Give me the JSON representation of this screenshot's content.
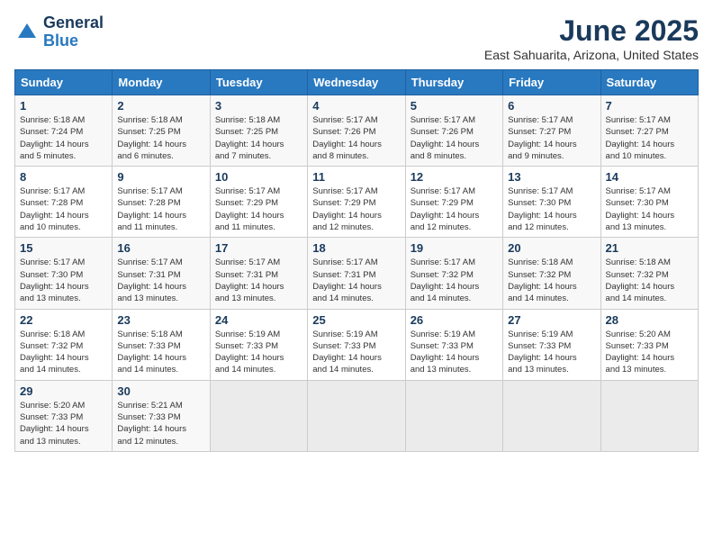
{
  "header": {
    "logo_line1": "General",
    "logo_line2": "Blue",
    "title": "June 2025",
    "subtitle": "East Sahuarita, Arizona, United States"
  },
  "weekdays": [
    "Sunday",
    "Monday",
    "Tuesday",
    "Wednesday",
    "Thursday",
    "Friday",
    "Saturday"
  ],
  "weeks": [
    [
      {
        "day": "1",
        "info": "Sunrise: 5:18 AM\nSunset: 7:24 PM\nDaylight: 14 hours\nand 5 minutes."
      },
      {
        "day": "2",
        "info": "Sunrise: 5:18 AM\nSunset: 7:25 PM\nDaylight: 14 hours\nand 6 minutes."
      },
      {
        "day": "3",
        "info": "Sunrise: 5:18 AM\nSunset: 7:25 PM\nDaylight: 14 hours\nand 7 minutes."
      },
      {
        "day": "4",
        "info": "Sunrise: 5:17 AM\nSunset: 7:26 PM\nDaylight: 14 hours\nand 8 minutes."
      },
      {
        "day": "5",
        "info": "Sunrise: 5:17 AM\nSunset: 7:26 PM\nDaylight: 14 hours\nand 8 minutes."
      },
      {
        "day": "6",
        "info": "Sunrise: 5:17 AM\nSunset: 7:27 PM\nDaylight: 14 hours\nand 9 minutes."
      },
      {
        "day": "7",
        "info": "Sunrise: 5:17 AM\nSunset: 7:27 PM\nDaylight: 14 hours\nand 10 minutes."
      }
    ],
    [
      {
        "day": "8",
        "info": "Sunrise: 5:17 AM\nSunset: 7:28 PM\nDaylight: 14 hours\nand 10 minutes."
      },
      {
        "day": "9",
        "info": "Sunrise: 5:17 AM\nSunset: 7:28 PM\nDaylight: 14 hours\nand 11 minutes."
      },
      {
        "day": "10",
        "info": "Sunrise: 5:17 AM\nSunset: 7:29 PM\nDaylight: 14 hours\nand 11 minutes."
      },
      {
        "day": "11",
        "info": "Sunrise: 5:17 AM\nSunset: 7:29 PM\nDaylight: 14 hours\nand 12 minutes."
      },
      {
        "day": "12",
        "info": "Sunrise: 5:17 AM\nSunset: 7:29 PM\nDaylight: 14 hours\nand 12 minutes."
      },
      {
        "day": "13",
        "info": "Sunrise: 5:17 AM\nSunset: 7:30 PM\nDaylight: 14 hours\nand 12 minutes."
      },
      {
        "day": "14",
        "info": "Sunrise: 5:17 AM\nSunset: 7:30 PM\nDaylight: 14 hours\nand 13 minutes."
      }
    ],
    [
      {
        "day": "15",
        "info": "Sunrise: 5:17 AM\nSunset: 7:30 PM\nDaylight: 14 hours\nand 13 minutes."
      },
      {
        "day": "16",
        "info": "Sunrise: 5:17 AM\nSunset: 7:31 PM\nDaylight: 14 hours\nand 13 minutes."
      },
      {
        "day": "17",
        "info": "Sunrise: 5:17 AM\nSunset: 7:31 PM\nDaylight: 14 hours\nand 13 minutes."
      },
      {
        "day": "18",
        "info": "Sunrise: 5:17 AM\nSunset: 7:31 PM\nDaylight: 14 hours\nand 14 minutes."
      },
      {
        "day": "19",
        "info": "Sunrise: 5:17 AM\nSunset: 7:32 PM\nDaylight: 14 hours\nand 14 minutes."
      },
      {
        "day": "20",
        "info": "Sunrise: 5:18 AM\nSunset: 7:32 PM\nDaylight: 14 hours\nand 14 minutes."
      },
      {
        "day": "21",
        "info": "Sunrise: 5:18 AM\nSunset: 7:32 PM\nDaylight: 14 hours\nand 14 minutes."
      }
    ],
    [
      {
        "day": "22",
        "info": "Sunrise: 5:18 AM\nSunset: 7:32 PM\nDaylight: 14 hours\nand 14 minutes."
      },
      {
        "day": "23",
        "info": "Sunrise: 5:18 AM\nSunset: 7:33 PM\nDaylight: 14 hours\nand 14 minutes."
      },
      {
        "day": "24",
        "info": "Sunrise: 5:19 AM\nSunset: 7:33 PM\nDaylight: 14 hours\nand 14 minutes."
      },
      {
        "day": "25",
        "info": "Sunrise: 5:19 AM\nSunset: 7:33 PM\nDaylight: 14 hours\nand 14 minutes."
      },
      {
        "day": "26",
        "info": "Sunrise: 5:19 AM\nSunset: 7:33 PM\nDaylight: 14 hours\nand 13 minutes."
      },
      {
        "day": "27",
        "info": "Sunrise: 5:19 AM\nSunset: 7:33 PM\nDaylight: 14 hours\nand 13 minutes."
      },
      {
        "day": "28",
        "info": "Sunrise: 5:20 AM\nSunset: 7:33 PM\nDaylight: 14 hours\nand 13 minutes."
      }
    ],
    [
      {
        "day": "29",
        "info": "Sunrise: 5:20 AM\nSunset: 7:33 PM\nDaylight: 14 hours\nand 13 minutes."
      },
      {
        "day": "30",
        "info": "Sunrise: 5:21 AM\nSunset: 7:33 PM\nDaylight: 14 hours\nand 12 minutes."
      },
      {
        "day": "",
        "info": ""
      },
      {
        "day": "",
        "info": ""
      },
      {
        "day": "",
        "info": ""
      },
      {
        "day": "",
        "info": ""
      },
      {
        "day": "",
        "info": ""
      }
    ]
  ]
}
